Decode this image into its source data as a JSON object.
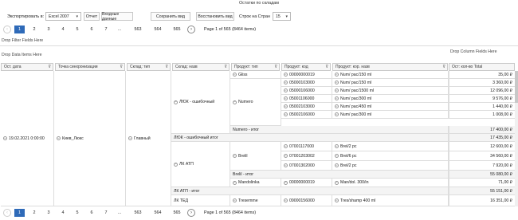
{
  "title": "Остатки по складам",
  "toolbar": {
    "export_label": "Экспортировать в:",
    "export_value": "Excel 2007",
    "report_btn": "Отчет",
    "input_btn": "Входные данные",
    "save_view": "Сохранить вид",
    "restore_view": "Восстановить вид",
    "rows_label": "Строк на Стран",
    "rows_value": "15"
  },
  "pager": {
    "pages": [
      "1",
      "2",
      "3",
      "4",
      "5",
      "6",
      "7",
      "...",
      "563",
      "564",
      "565"
    ],
    "summary": "Page 1 of 565 (8464 items)"
  },
  "zones": {
    "filter": "Drop Filter Fields Here",
    "column": "Drop Column Fields Here",
    "data": "Drop Data Items Here"
  },
  "headers": [
    "Ост. дата",
    "Точка синхронизации",
    "Склад: тип",
    "Склад: назв",
    "Продукт: тип",
    "Продукт: код",
    "Продукт: кор. назв",
    "Ост: кол-во Total"
  ],
  "grid": {
    "date": "19.02.2021 0:00:00",
    "point": "Киев_Люкс",
    "stype": "Главный",
    "wh1": "ЛЮК - ошибочный",
    "wh1_total": "ЛЮК - ошибочный итог",
    "wh2": "ЛК АТП",
    "wh2_total": "ЛК АТП - итог",
    "wh3": "ЛК ТЕД",
    "gliss": "Gliss",
    "numero": "Numero",
    "numero_total": "Numero - итог",
    "brelil": "Brelil",
    "brelil_total": "Brelil - итог",
    "mandolinka": "Mandolinka",
    "tresemme": "Tresemme"
  },
  "rows": [
    {
      "code": "00000000019",
      "name": "Num/ рас/150 ml",
      "value": "35,00 ₽"
    },
    {
      "code": "05000103000",
      "name": "Num/ рас/150 ml",
      "value": "3 360,00 ₽"
    },
    {
      "code": "05000106000",
      "name": "Num/ рас/1500 ml",
      "value": "12 096,00 ₽"
    },
    {
      "code": "05001106000",
      "name": "Num/ рас/300 ml",
      "value": "9 576,00 ₽"
    },
    {
      "code": "05002103000",
      "name": "Num/ рас/450 ml",
      "value": "1 440,00 ₽"
    },
    {
      "code": "05002106000",
      "name": "Num/ рас/300 ml",
      "value": "1 008,00 ₽"
    },
    {
      "code": "",
      "name": "",
      "value": "17 400,00 ₽"
    },
    {
      "code": "",
      "name": "",
      "value": "17 435,00 ₽"
    },
    {
      "code": "07001117000",
      "name": "Brel/2 pc",
      "value": "12 600,00 ₽"
    },
    {
      "code": "07001203002",
      "name": "Brel/6 pc",
      "value": "34 560,00 ₽"
    },
    {
      "code": "07001302000",
      "name": "Brel/2 pc",
      "value": "7 920,00 ₽"
    },
    {
      "code": "",
      "name": "",
      "value": "55 080,00 ₽"
    },
    {
      "code": "00000000019",
      "name": "Man/dol. 300/in",
      "value": "71,00 ₽"
    },
    {
      "code": "",
      "name": "",
      "value": "55 151,00 ₽"
    },
    {
      "code": "09000156000",
      "name": "Tres/shamp 400 ml",
      "value": "16 351,00 ₽"
    }
  ]
}
